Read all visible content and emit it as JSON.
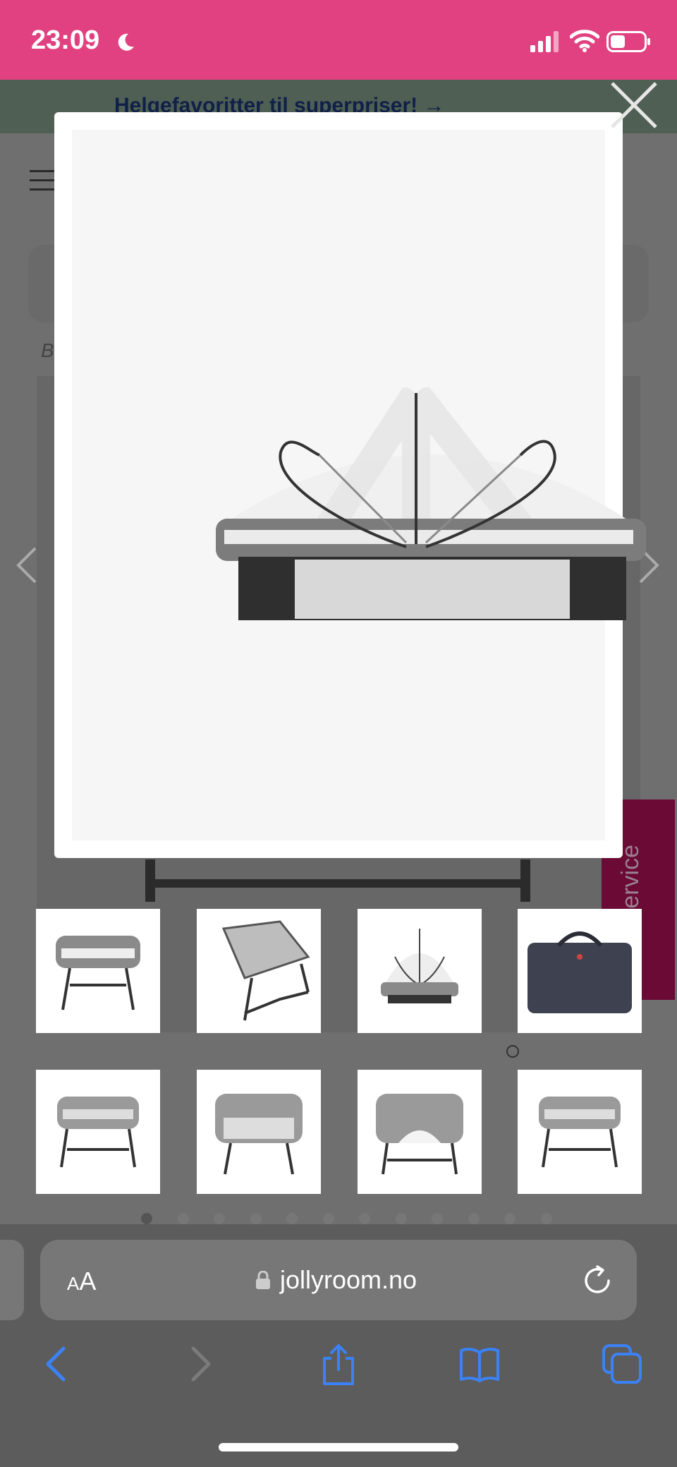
{
  "status_bar": {
    "time": "23:09",
    "icons": [
      "moon-icon",
      "cellular-signal-icon",
      "wifi-icon",
      "battery-icon"
    ]
  },
  "page": {
    "promo_banner": "Helgefavoritter til superpriser! →",
    "breadcrumb_initial": "B",
    "kundeservice_label": "Kundeservice",
    "carousel_dot_count": 12,
    "carousel_active_dot": 0
  },
  "modal": {
    "image_alt": "bedside crib with mosquito net"
  },
  "thumbnails": [
    {
      "name": "crib-front",
      "type": "crib-side"
    },
    {
      "name": "crib-angled",
      "type": "crib-angle"
    },
    {
      "name": "crib-net",
      "type": "crib-net"
    },
    {
      "name": "carry-bag",
      "type": "bag"
    },
    {
      "name": "crib-side",
      "type": "crib-plain"
    },
    {
      "name": "crib-front-2",
      "type": "crib-front"
    },
    {
      "name": "crib-open",
      "type": "crib-front-open"
    },
    {
      "name": "crib-side-2",
      "type": "crib-plain"
    }
  ],
  "browser": {
    "aa_label_small": "A",
    "aa_label_large": "A",
    "domain": "jollyroom.no"
  },
  "colors": {
    "status_bar": "#e14180",
    "browser_accent": "#3b82f6",
    "kundeservice": "#6a0a35"
  }
}
